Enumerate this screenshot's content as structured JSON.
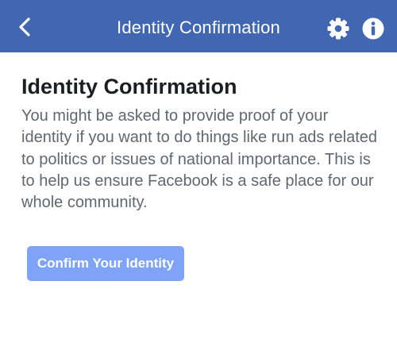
{
  "navbar": {
    "title": "Identity Confirmation",
    "back_icon": "chevron-left-icon",
    "settings_icon": "gear-icon",
    "info_icon": "info-icon",
    "background_color": "#4267b2"
  },
  "content": {
    "title": "Identity Confirmation",
    "body": "You might be asked to provide proof of your identity if you want to do things like run ads related to politics or issues of national importance. This is to help us ensure Facebook is a safe place for our whole community.",
    "button_label": "Confirm Your Identity",
    "button_color": "#7ea3f7"
  }
}
